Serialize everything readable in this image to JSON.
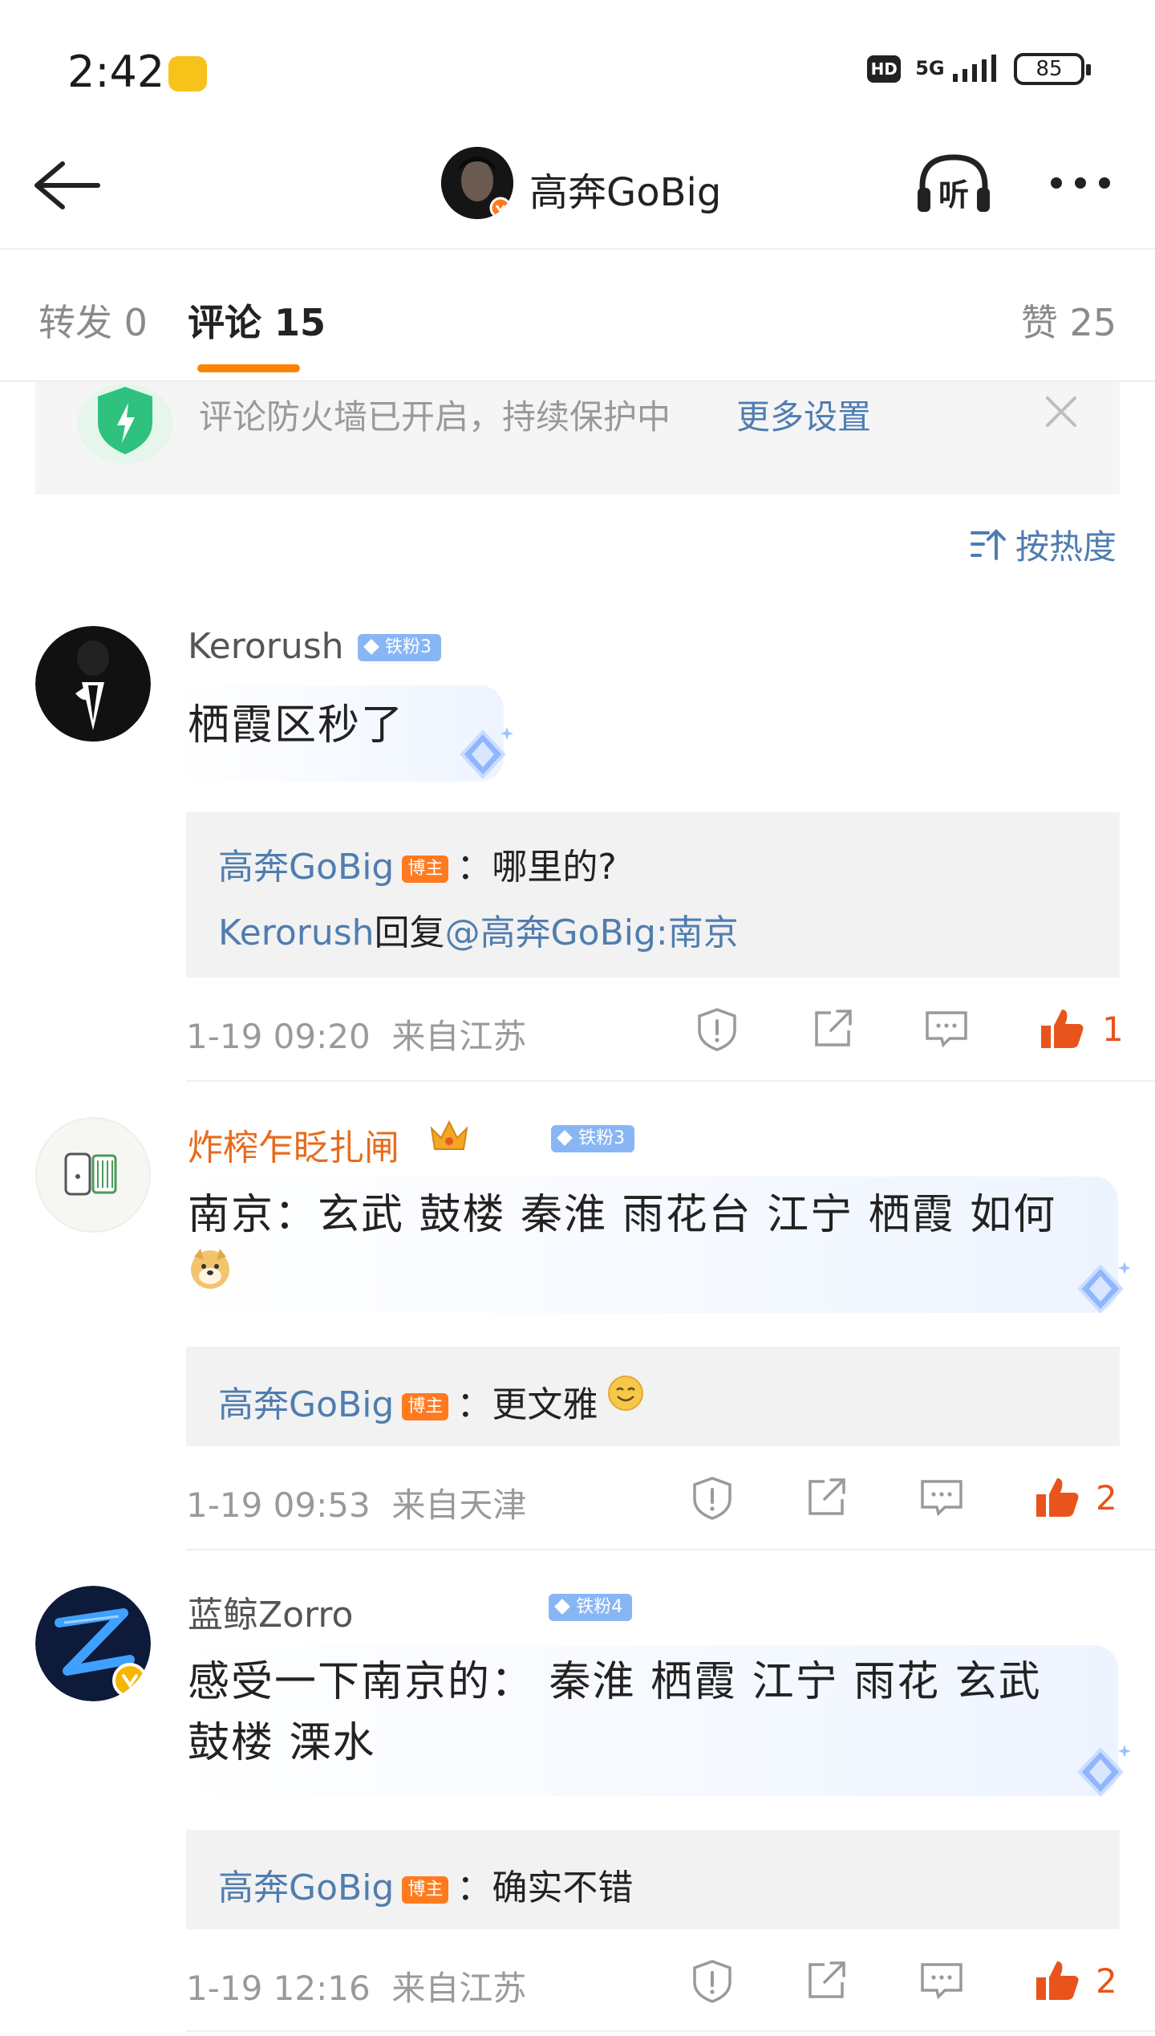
{
  "status_bar": {
    "time": "2:42",
    "hd": "HD",
    "network": "5G",
    "battery": "85"
  },
  "header": {
    "title": "高奔GoBig"
  },
  "tabs": {
    "repost": "转发 0",
    "comment": "评论 15",
    "like": "赞 25"
  },
  "banner": {
    "text": "评论防火墙已开启，持续保护中",
    "link": "更多设置"
  },
  "sort": {
    "label": "按热度"
  },
  "comments": [
    {
      "user": "Kerorush",
      "badge": "铁粉3",
      "text": "栖霞区秒了",
      "replies": [
        {
          "author": "高奔GoBig",
          "author_badge": "博主",
          "text": "：哪里的?"
        },
        {
          "author": "Kerorush",
          "middle": "回复",
          "mention": "@高奔GoBig",
          "text": ":南京"
        }
      ],
      "time": "1-19 09:20",
      "location": "来自江苏",
      "likes": "1"
    },
    {
      "user": "炸榨乍眨扎闸",
      "badge": "铁粉3",
      "text": "南京：玄武 鼓楼 秦淮 雨花台 江宁 栖霞 如何",
      "replies": [
        {
          "author": "高奔GoBig",
          "author_badge": "博主",
          "text": "：更文雅"
        }
      ],
      "time": "1-19 09:53",
      "location": "来自天津",
      "likes": "2"
    },
    {
      "user": "蓝鲸Zorro",
      "badge": "铁粉4",
      "text_line1": "感受一下南京的： 秦淮 栖霞 江宁 雨花 玄武",
      "text_line2": "鼓楼 溧水",
      "replies": [
        {
          "author": "高奔GoBig",
          "author_badge": "博主",
          "text": "：确实不错"
        }
      ],
      "time": "1-19 12:16",
      "location": "来自江苏",
      "likes": "2"
    }
  ],
  "colors": {
    "accent": "#ff8200",
    "link": "#507daf",
    "like": "#e8541b"
  }
}
